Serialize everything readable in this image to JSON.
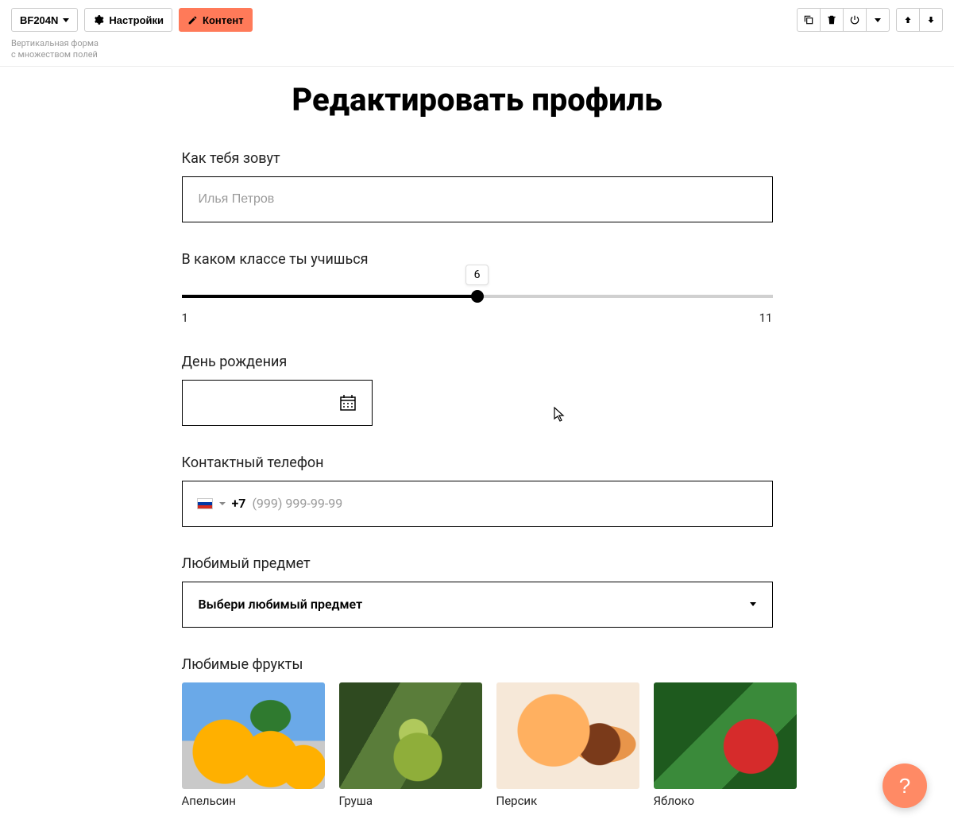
{
  "toolbar": {
    "block_id": "BF204N",
    "settings_label": "Настройки",
    "content_label": "Контент",
    "subtitle": "Вертикальная форма с множеством полей"
  },
  "page": {
    "title": "Редактировать профиль"
  },
  "form": {
    "name": {
      "label": "Как тебя зовут",
      "placeholder": "Илья Петров",
      "value": ""
    },
    "grade": {
      "label": "В каком классе ты учишься",
      "min": "1",
      "max": "11",
      "value": "6",
      "percent": 50
    },
    "birthday": {
      "label": "День рождения",
      "value": ""
    },
    "phone": {
      "label": "Контактный телефон",
      "prefix": "+7",
      "placeholder": "(999) 999-99-99",
      "value": ""
    },
    "subject": {
      "label": "Любимый предмет",
      "placeholder": "Выбери любимый предмет"
    },
    "fruits": {
      "label": "Любимые фрукты",
      "items": [
        {
          "name": "Апельсин"
        },
        {
          "name": "Груша"
        },
        {
          "name": "Персик"
        },
        {
          "name": "Яблоко"
        }
      ]
    }
  },
  "help": {
    "symbol": "?"
  }
}
